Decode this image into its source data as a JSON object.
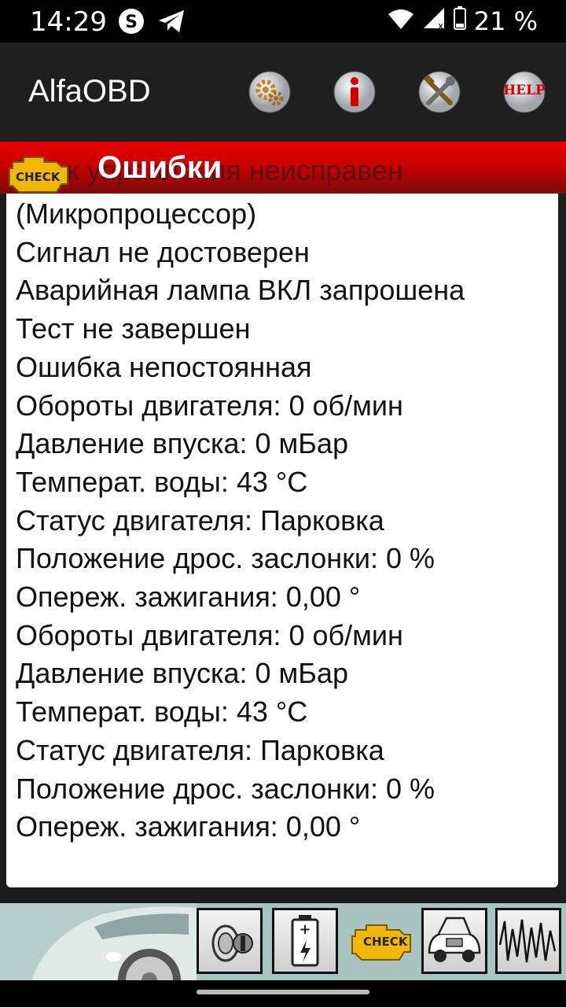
{
  "status_bar": {
    "time": "14:29",
    "battery": "21 %",
    "icons": [
      "shazam-icon",
      "telegram-icon",
      "wifi-icon",
      "signal-icon",
      "battery-icon"
    ]
  },
  "app_bar": {
    "title": "AlfaOBD",
    "tools": [
      "settings-gears-icon",
      "info-icon",
      "tools-icon",
      "help-icon"
    ],
    "help_label": "HELP"
  },
  "header": {
    "title": "Ошибки",
    "ghost_text": "Блок управления неисправен",
    "badge_label": "CHECK"
  },
  "content": {
    "lines": [
      "(Микропроцессор)",
      "Сигнал не достоверен",
      "Аварийная лампа ВКЛ запрошена",
      "Тест не завершен",
      "Ошибка непостоянная",
      "Обороты двигателя: 0 об/мин",
      "Давление впуска: 0 мБар",
      "Температ. воды: 43 °C",
      "Статус двигателя: Парковка",
      "Положение дрос. заслонки: 0 %",
      "Опереж. зажигания: 0,00 °",
      "Обороты двигателя: 0 об/мин",
      "Давление впуска: 0 мБар",
      "Температ. воды: 43 °C",
      "Статус двигателя: Парковка",
      "Положение дрос. заслонки: 0 %",
      "Опереж. зажигания: 0,00 °"
    ]
  },
  "bottom_bar": {
    "buttons": [
      "ignition-key-icon",
      "battery-charge-icon",
      "check-engine-icon",
      "car-hood-icon",
      "waveform-icon"
    ],
    "check_label": "CHECK"
  },
  "colors": {
    "header_red": "#e80000",
    "check_yellow": "#f2b705",
    "app_bar_bg": "#1f1f1f"
  }
}
